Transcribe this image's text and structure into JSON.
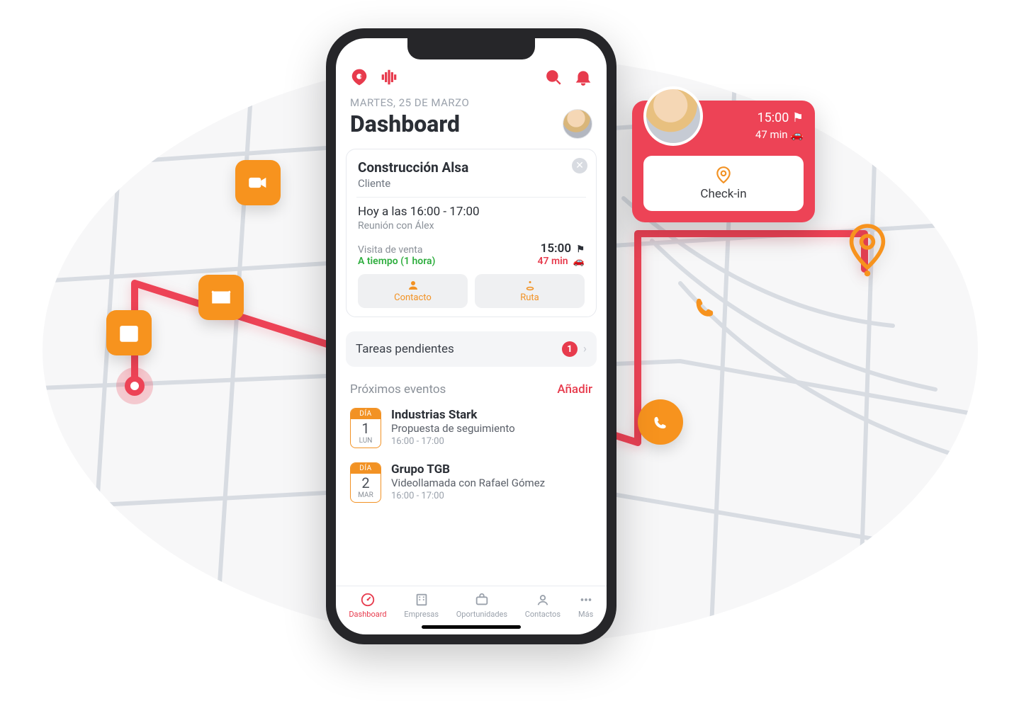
{
  "header": {
    "date_line": "MARTES, 25 DE MARZO",
    "title": "Dashboard"
  },
  "card": {
    "company": "Construcción Alsa",
    "role": "Cliente",
    "when": "Hoy a las 16:00 - 17:00",
    "meeting": "Reunión con Álex",
    "visit_label": "Visita de venta",
    "ontime": "A tiempo  (1 hora)",
    "time": "15:00",
    "travel": "47 min",
    "btn_contact": "Contacto",
    "btn_route": "Ruta"
  },
  "pending": {
    "label": "Tareas pendientes",
    "count": "1"
  },
  "upcoming": {
    "label": "Próximos eventos",
    "add": "Añadir",
    "events": [
      {
        "day_label": "DÍA",
        "day": "1",
        "month": "LUN",
        "name": "Industrias Stark",
        "desc": "Propuesta de seguimiento",
        "range": "16:00 - 17:00"
      },
      {
        "day_label": "DÍA",
        "day": "2",
        "month": "MAR",
        "name": "Grupo TGB",
        "desc": "Videollamada con Rafael Gómez",
        "range": "16:00 - 17:00"
      }
    ]
  },
  "tabs": {
    "dashboard": "Dashboard",
    "companies": "Empresas",
    "opportunities": "Oportunidades",
    "contacts": "Contactos",
    "more": "Más"
  },
  "popover": {
    "time": "15:00",
    "travel": "47 min",
    "checkin": "Check-in"
  },
  "colors": {
    "accent_red": "#e73b4d",
    "accent_orange": "#f29224",
    "gray_text": "#8a9098"
  }
}
